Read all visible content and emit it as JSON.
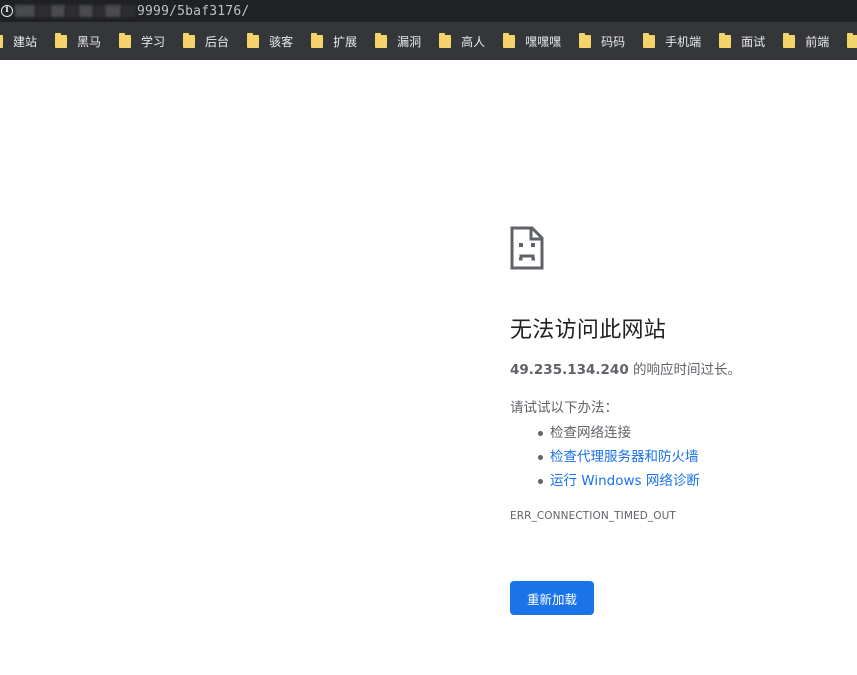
{
  "address_bar": {
    "url_visible": "9999/5baf3176/"
  },
  "bookmarks": [
    {
      "label": "建站"
    },
    {
      "label": "黑马"
    },
    {
      "label": "学习"
    },
    {
      "label": "后台"
    },
    {
      "label": "骇客"
    },
    {
      "label": "扩展"
    },
    {
      "label": "漏洞"
    },
    {
      "label": "高人"
    },
    {
      "label": "嘿嘿嘿"
    },
    {
      "label": "码码"
    },
    {
      "label": "手机端"
    },
    {
      "label": "面试"
    },
    {
      "label": "前端"
    }
  ],
  "error": {
    "icon": "sad-document-icon",
    "title": "无法访问此网站",
    "host": "49.235.134.240",
    "desc_suffix": " 的响应时间过长。",
    "suggest_heading": "请试试以下办法：",
    "suggestions": [
      {
        "text": "检查网络连接",
        "link": false
      },
      {
        "text": "检查代理服务器和防火墙",
        "link": true
      },
      {
        "text": "运行 Windows 网络诊断",
        "link": true
      }
    ],
    "code": "ERR_CONNECTION_TIMED_OUT",
    "reload_label": "重新加载"
  },
  "colors": {
    "toolbar_bg": "#202124",
    "bookmarks_bg": "#35363a",
    "folder": "#f4d36a",
    "link": "#1a73e8",
    "button": "#1a73e8",
    "text_secondary": "#5f6368",
    "text_primary": "#202124"
  }
}
